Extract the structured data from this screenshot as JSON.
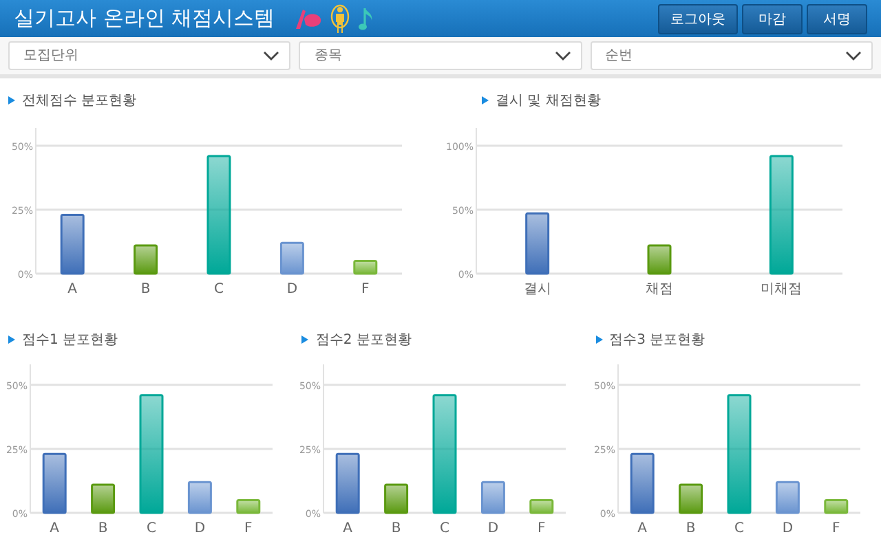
{
  "header": {
    "title": "실기고사 온라인 채점시스템",
    "buttons": [
      "로그아웃",
      "마감",
      "서명"
    ]
  },
  "filters": [
    {
      "placeholder": "모집단위"
    },
    {
      "placeholder": "종목"
    },
    {
      "placeholder": "순번"
    }
  ],
  "top_panels": [
    {
      "title": "전체점수 분포현황",
      "chart_data": {
        "type": "bar",
        "categories": [
          "A",
          "B",
          "C",
          "D",
          "F"
        ],
        "ylim": [
          0,
          57
        ],
        "yticks": [
          {
            "value": 0,
            "label": "0%"
          },
          {
            "value": 25,
            "label": "25%"
          },
          {
            "value": 50,
            "label": "50%"
          }
        ],
        "series": [
          {
            "color": "#3f6fb8",
            "values": [
              23,
              null,
              null,
              null,
              null
            ]
          },
          {
            "color": "#5a9a10",
            "values": [
              null,
              11,
              null,
              null,
              null
            ]
          },
          {
            "color": "#00a898",
            "values": [
              null,
              null,
              46,
              null,
              null
            ]
          },
          {
            "color": "#6a94d0",
            "values": [
              null,
              null,
              null,
              12,
              null
            ]
          },
          {
            "color": "#7ab83a",
            "values": [
              null,
              null,
              null,
              null,
              5
            ]
          }
        ]
      }
    },
    {
      "title": "결시 및 채점현황",
      "chart_data": {
        "type": "bar",
        "categories": [
          "결시",
          "채점",
          "미채점"
        ],
        "ylim": [
          0,
          114
        ],
        "yticks": [
          {
            "value": 0,
            "label": "0%"
          },
          {
            "value": 50,
            "label": "50%"
          },
          {
            "value": 100,
            "label": "100%"
          }
        ],
        "series": [
          {
            "color": "#3f6fb8",
            "values": [
              47,
              null,
              null
            ]
          },
          {
            "color": "#5a9a10",
            "values": [
              null,
              22,
              null
            ]
          },
          {
            "color": "#00a898",
            "values": [
              null,
              null,
              92
            ]
          }
        ]
      }
    }
  ],
  "bottom_panels": [
    {
      "title": "점수1 분포현황",
      "chart_data": {
        "type": "bar",
        "categories": [
          "A",
          "B",
          "C",
          "D",
          "F"
        ],
        "ylim": [
          0,
          58
        ],
        "yticks": [
          {
            "value": 0,
            "label": "0%"
          },
          {
            "value": 25,
            "label": "25%"
          },
          {
            "value": 50,
            "label": "50%"
          }
        ],
        "series": [
          {
            "color": "#3f6fb8",
            "values": [
              23,
              null,
              null,
              null,
              null
            ]
          },
          {
            "color": "#5a9a10",
            "values": [
              null,
              11,
              null,
              null,
              null
            ]
          },
          {
            "color": "#00a898",
            "values": [
              null,
              null,
              46,
              null,
              null
            ]
          },
          {
            "color": "#6a94d0",
            "values": [
              null,
              null,
              null,
              12,
              null
            ]
          },
          {
            "color": "#7ab83a",
            "values": [
              null,
              null,
              null,
              null,
              5
            ]
          }
        ]
      }
    },
    {
      "title": "점수2 분포현황",
      "chart_data": {
        "type": "bar",
        "categories": [
          "A",
          "B",
          "C",
          "D",
          "F"
        ],
        "ylim": [
          0,
          58
        ],
        "yticks": [
          {
            "value": 0,
            "label": "0%"
          },
          {
            "value": 25,
            "label": "25%"
          },
          {
            "value": 50,
            "label": "50%"
          }
        ],
        "series": [
          {
            "color": "#3f6fb8",
            "values": [
              23,
              null,
              null,
              null,
              null
            ]
          },
          {
            "color": "#5a9a10",
            "values": [
              null,
              11,
              null,
              null,
              null
            ]
          },
          {
            "color": "#00a898",
            "values": [
              null,
              null,
              46,
              null,
              null
            ]
          },
          {
            "color": "#6a94d0",
            "values": [
              null,
              null,
              null,
              12,
              null
            ]
          },
          {
            "color": "#7ab83a",
            "values": [
              null,
              null,
              null,
              null,
              5
            ]
          }
        ]
      }
    },
    {
      "title": "점수3 분포현황",
      "chart_data": {
        "type": "bar",
        "categories": [
          "A",
          "B",
          "C",
          "D",
          "F"
        ],
        "ylim": [
          0,
          58
        ],
        "yticks": [
          {
            "value": 0,
            "label": "0%"
          },
          {
            "value": 25,
            "label": "25%"
          },
          {
            "value": 50,
            "label": "50%"
          }
        ],
        "series": [
          {
            "color": "#3f6fb8",
            "values": [
              23,
              null,
              null,
              null,
              null
            ]
          },
          {
            "color": "#5a9a10",
            "values": [
              null,
              11,
              null,
              null,
              null
            ]
          },
          {
            "color": "#00a898",
            "values": [
              null,
              null,
              46,
              null,
              null
            ]
          },
          {
            "color": "#6a94d0",
            "values": [
              null,
              null,
              null,
              12,
              null
            ]
          },
          {
            "color": "#7ab83a",
            "values": [
              null,
              null,
              null,
              null,
              5
            ]
          }
        ]
      }
    }
  ]
}
